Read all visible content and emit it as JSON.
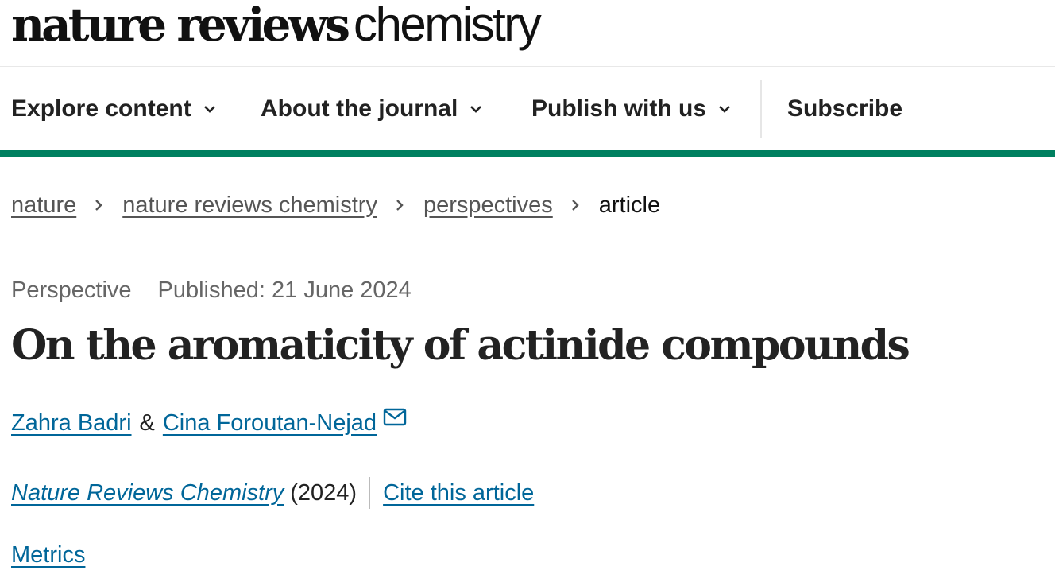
{
  "header": {
    "logo_bold": "nature reviews",
    "logo_light": "chemistry"
  },
  "nav": {
    "items": [
      {
        "label": "Explore content",
        "icon": "chevron-down-icon"
      },
      {
        "label": "About the journal",
        "icon": "chevron-down-icon"
      },
      {
        "label": "Publish with us",
        "icon": "chevron-down-icon"
      },
      {
        "label": "Subscribe"
      }
    ]
  },
  "colors": {
    "accent_bar": "#008060",
    "link": "#006699",
    "text": "#222222",
    "muted": "#666666"
  },
  "breadcrumb": {
    "items": [
      "nature",
      "nature reviews chemistry",
      "perspectives",
      "article"
    ],
    "separator_icon": "chevron-right-icon"
  },
  "article": {
    "type": "Perspective",
    "published": "Published: 21 June 2024",
    "title": "On the aromaticity of actinide compounds",
    "authors": [
      "Zahra Badri",
      "Cina Foroutan-Nejad"
    ],
    "authors_joiner": "&",
    "corresponding_icon": "mail-icon",
    "journal": "Nature Reviews Chemistry",
    "year": "(2024)",
    "cite_label": "Cite this article",
    "metrics_label": "Metrics"
  }
}
